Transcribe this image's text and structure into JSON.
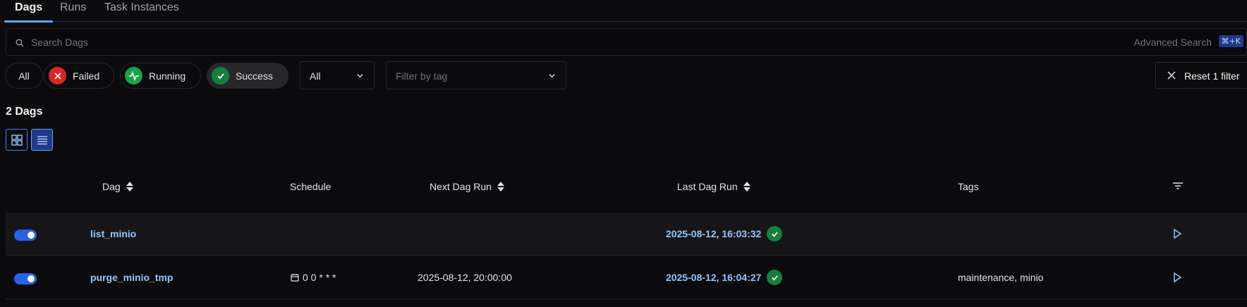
{
  "tabs": [
    {
      "label": "Dags"
    },
    {
      "label": "Runs"
    },
    {
      "label": "Task Instances"
    }
  ],
  "search": {
    "placeholder": "Search Dags",
    "advanced_label": "Advanced Search",
    "shortcut": "⌘+K"
  },
  "filters": {
    "state_pills": [
      {
        "label": "All",
        "selected": false
      },
      {
        "label": "Failed",
        "icon": "x-circle-icon",
        "color": "#dc2626",
        "selected": false
      },
      {
        "label": "Running",
        "icon": "activity-icon",
        "color": "#16a34a",
        "selected": false
      },
      {
        "label": "Success",
        "icon": "check-circle-icon",
        "color": "#15803d",
        "selected": true
      }
    ],
    "paused_select": {
      "value": "All"
    },
    "tag_select": {
      "placeholder": "Filter by tag"
    },
    "reset_label": "Reset 1 filter"
  },
  "summary": {
    "count_label": "2 Dags"
  },
  "view_toggle": {
    "options": [
      "card-view",
      "table-view"
    ],
    "selected": "table-view"
  },
  "table": {
    "columns": [
      "Dag",
      "Schedule",
      "Next Dag Run",
      "Last Dag Run",
      "Tags"
    ],
    "rows": [
      {
        "enabled": true,
        "dag": "list_minio",
        "schedule": "",
        "next_run": "",
        "last_run": "2025-08-12, 16:03:32",
        "last_run_state": "success",
        "tags": ""
      },
      {
        "enabled": true,
        "dag": "purge_minio_tmp",
        "schedule": "0 0 * * *",
        "next_run": "2025-08-12, 20:00:00",
        "last_run": "2025-08-12, 16:04:27",
        "last_run_state": "success",
        "tags": "maintenance, minio"
      }
    ]
  },
  "colors": {
    "background": "#0b0b0d",
    "accent": "#60a5fa",
    "link": "#93c5fd",
    "success": "#15803d",
    "failed": "#dc2626",
    "toggle_on": "#2563eb"
  }
}
